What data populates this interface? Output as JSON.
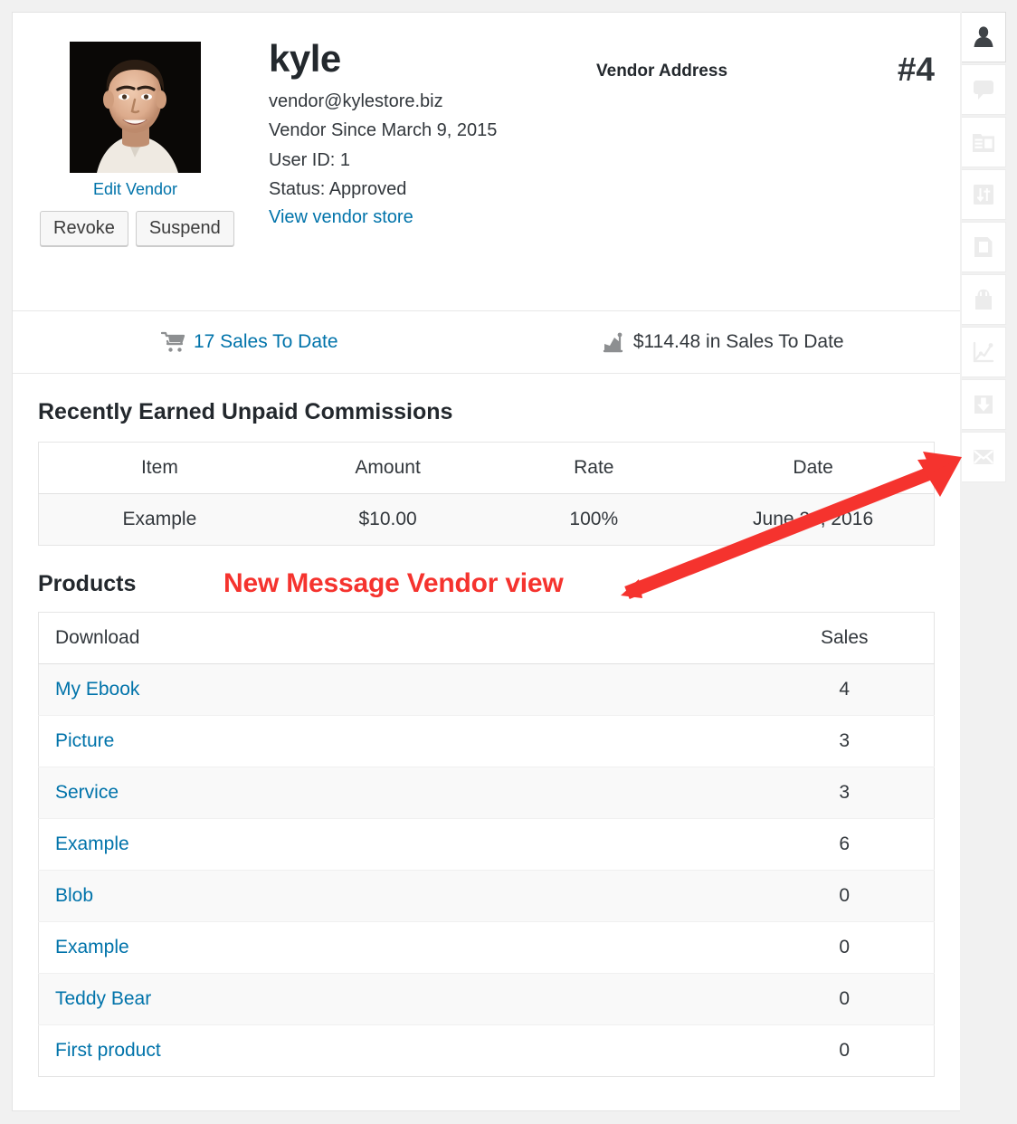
{
  "vendor": {
    "name": "kyle",
    "email": "vendor@kylestore.biz",
    "since": "Vendor Since March 9, 2015",
    "user_id": "User ID:  1",
    "status": "Status:  Approved",
    "store_link": "View vendor store",
    "edit_link": "Edit Vendor",
    "order_number": "#4",
    "address_title": "Vendor Address",
    "avatar_alt": "vendor-avatar"
  },
  "actions": {
    "revoke": "Revoke",
    "suspend": "Suspend"
  },
  "stats": {
    "sales_count": "17 Sales To Date",
    "sales_total": "$114.48 in Sales To Date"
  },
  "commissions": {
    "title": "Recently Earned Unpaid Commissions",
    "columns": [
      "Item",
      "Amount",
      "Rate",
      "Date"
    ],
    "rows": [
      [
        "Example",
        "$10.00",
        "100%",
        "June 26, 2016"
      ]
    ]
  },
  "products": {
    "title": "Products",
    "columns": [
      "Download",
      "Sales"
    ],
    "rows": [
      [
        "My Ebook",
        "4"
      ],
      [
        "Picture",
        "3"
      ],
      [
        "Service",
        "3"
      ],
      [
        "Example",
        "6"
      ],
      [
        "Blob",
        "0"
      ],
      [
        "Example",
        "0"
      ],
      [
        "Teddy Bear",
        "0"
      ],
      [
        "First product",
        "0"
      ]
    ]
  },
  "annotation": {
    "text": "New Message Vendor view",
    "color": "#f5332e"
  },
  "rail": {
    "items": [
      {
        "icon": "user-icon",
        "active": true
      },
      {
        "icon": "comment-icon",
        "active": false
      },
      {
        "icon": "store-icon",
        "active": false
      },
      {
        "icon": "settings-sliders-icon",
        "active": false
      },
      {
        "icon": "pages-icon",
        "active": false
      },
      {
        "icon": "shopping-bag-icon",
        "active": false
      },
      {
        "icon": "chart-line-icon",
        "active": false
      },
      {
        "icon": "download-icon",
        "active": false
      },
      {
        "icon": "envelope-icon",
        "active": false
      }
    ]
  },
  "colors": {
    "link": "#0073aa",
    "text": "#32373c",
    "page_bg": "#f1f1f1",
    "card_bg": "#ffffff",
    "row_alt": "#f9f9f9",
    "border": "#e5e5e5",
    "icon_gray": "#b4b9be",
    "icon_active": "#3f4347",
    "annotation": "#f5332e"
  }
}
